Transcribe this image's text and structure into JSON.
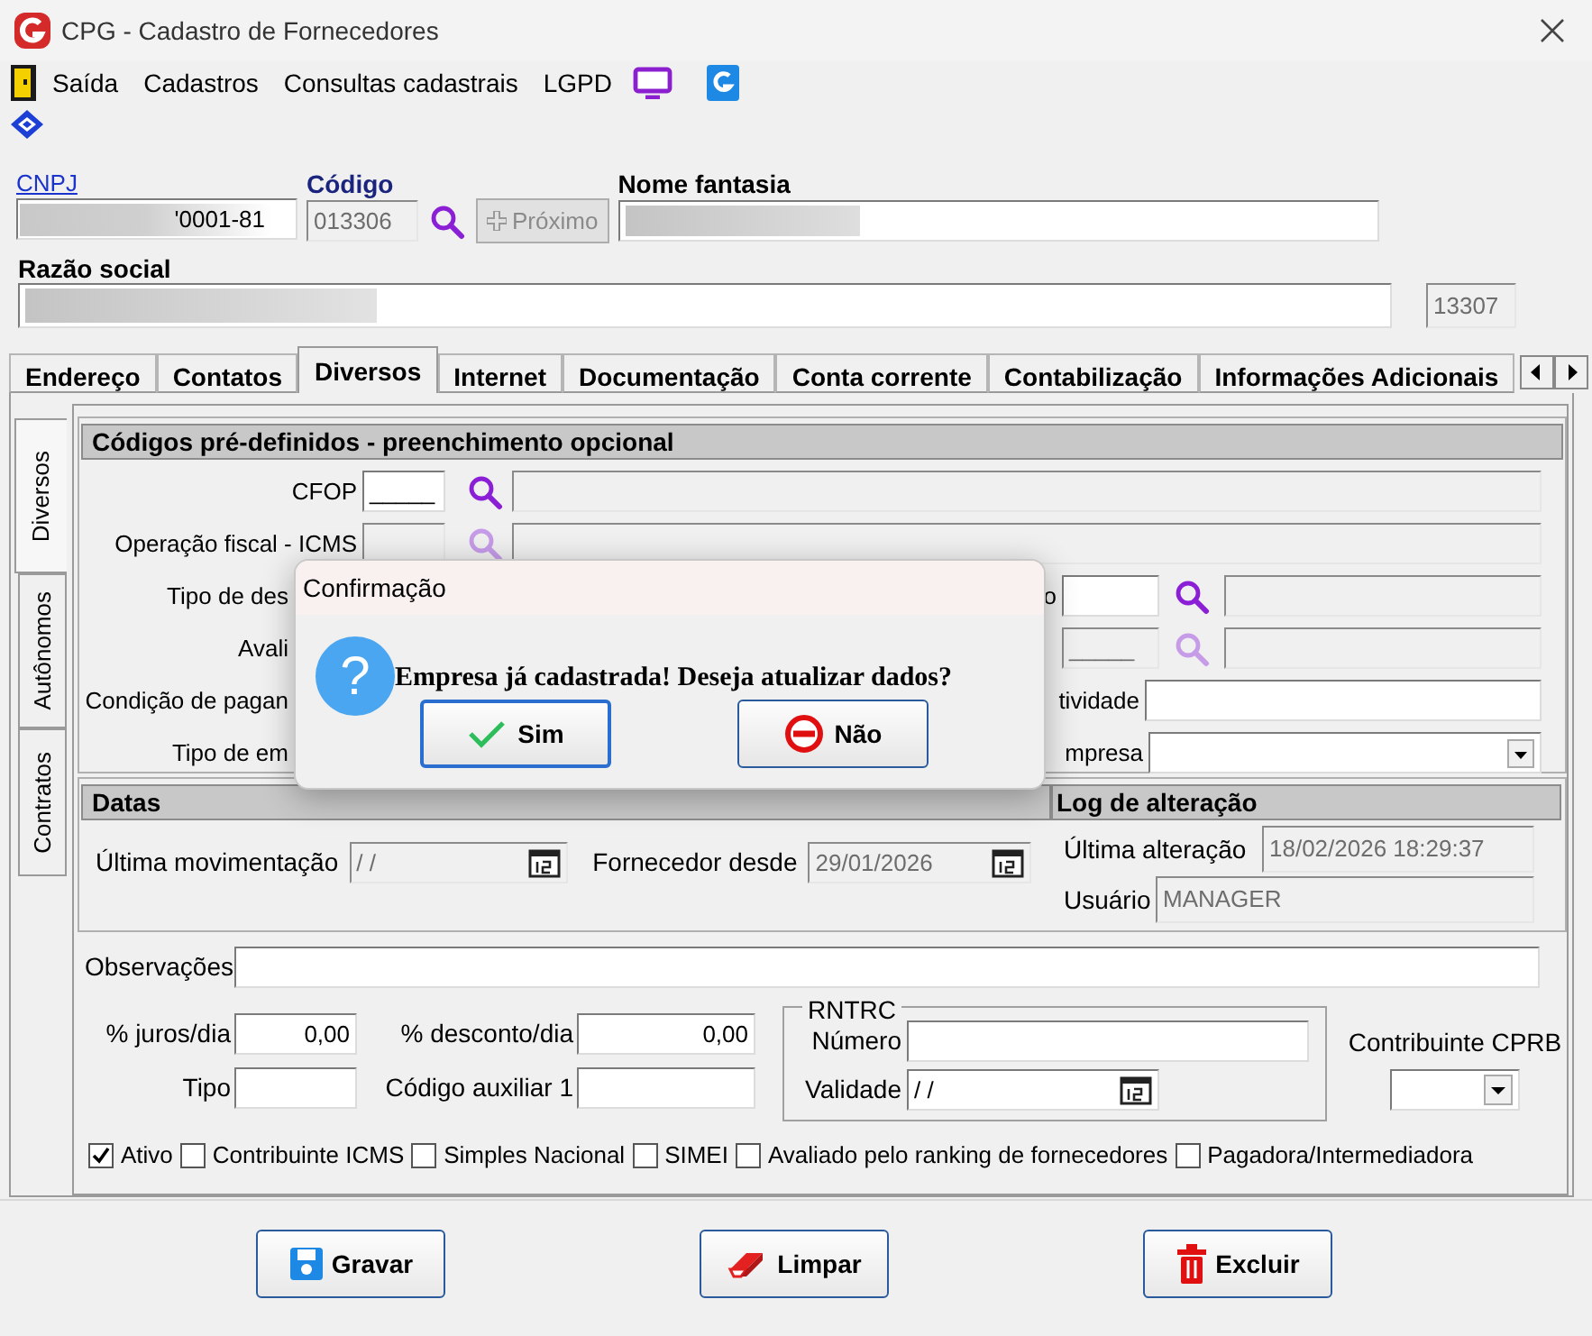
{
  "window": {
    "title": "CPG - Cadastro de Fornecedores"
  },
  "menu": [
    {
      "label": "Saída"
    },
    {
      "label": "Cadastros"
    },
    {
      "label": "Consultas cadastrais"
    },
    {
      "label": "LGPD"
    }
  ],
  "header": {
    "cnpj": {
      "label": "CNPJ",
      "value": "'0001-81"
    },
    "codigo": {
      "label": "Código",
      "value": "013306"
    },
    "proximo": {
      "label": "Próximo",
      "disabled": true
    },
    "nome_fantasia": {
      "label": "Nome fantasia"
    },
    "razao_social": {
      "label": "Razão social"
    },
    "numero": "13307"
  },
  "tabs": [
    {
      "label": "Endereço",
      "selected": false
    },
    {
      "label": "Contatos",
      "selected": false
    },
    {
      "label": "Diversos",
      "selected": true
    },
    {
      "label": "Internet",
      "selected": false
    },
    {
      "label": "Documentação",
      "selected": false
    },
    {
      "label": "Conta corrente",
      "selected": false
    },
    {
      "label": "Contabilização",
      "selected": false
    },
    {
      "label": "Informações Adicionais",
      "selected": false
    }
  ],
  "side_tabs": [
    {
      "label": "Diversos",
      "selected": true
    },
    {
      "label": "Autônomos",
      "selected": false
    },
    {
      "label": "Contratos",
      "selected": false
    }
  ],
  "codigos": {
    "title": "Códigos pré-definidos - preenchimento opcional",
    "rows": [
      {
        "kind": "lookup",
        "label": "CFOP",
        "value": "_____",
        "lookup_enabled": true
      },
      {
        "kind": "lookup",
        "label": "Operação fiscal - ICMS",
        "lookup_enabled": false
      },
      {
        "kind": "split",
        "label": "Tipo de des",
        "right_label": "o",
        "lookup_enabled": true
      },
      {
        "kind": "split",
        "label": "Avali",
        "right_value": "_____",
        "lookup_enabled": false
      },
      {
        "kind": "text",
        "label": "Condição de pagan",
        "right_label": "tividade"
      },
      {
        "kind": "select",
        "label": "Tipo de em",
        "right_label": "mpresa"
      }
    ]
  },
  "datas": {
    "title": "Datas",
    "ultima_movimentacao": {
      "label": "Última movimentação",
      "value": " / /"
    },
    "fornecedor_desde": {
      "label": "Fornecedor desde",
      "value": "29/01/2026"
    }
  },
  "log": {
    "title": "Log de alteração",
    "ultima_alteracao": {
      "label": "Última alteração",
      "value": "18/02/2026 18:29:37"
    },
    "usuario": {
      "label": "Usuário",
      "value": "MANAGER"
    }
  },
  "observacoes": {
    "label": "Observações"
  },
  "juros": {
    "label": "% juros/dia",
    "value": "0,00"
  },
  "desconto": {
    "label": "% desconto/dia",
    "value": "0,00"
  },
  "tipo": {
    "label": "Tipo"
  },
  "codigo_auxiliar": {
    "label": "Código auxiliar 1"
  },
  "rntrc": {
    "title": "RNTRC",
    "numero": {
      "label": "Número"
    },
    "validade": {
      "label": "Validade",
      "value": " / /"
    }
  },
  "cprb": {
    "label": "Contribuinte CPRB"
  },
  "checkboxes": [
    {
      "label": "Ativo",
      "checked": true
    },
    {
      "label": "Contribuinte ICMS",
      "checked": false
    },
    {
      "label": "Simples Nacional",
      "checked": false
    },
    {
      "label": "SIMEI",
      "checked": false
    },
    {
      "label": "Avaliado pelo ranking de fornecedores",
      "checked": false
    },
    {
      "label": "Pagadora/Intermediadora",
      "checked": false
    }
  ],
  "buttons": [
    {
      "kind": "save",
      "label": "Gravar"
    },
    {
      "kind": "clear",
      "label": "Limpar"
    },
    {
      "kind": "delete",
      "label": "Excluir"
    }
  ],
  "dialog": {
    "title": "Confirmação",
    "icon": "?",
    "message": "Empresa já cadastrada! Deseja atualizar dados?",
    "buttons": [
      {
        "kind": "yes",
        "label": "Sim",
        "selected": true
      },
      {
        "kind": "no",
        "label": "Não",
        "selected": false
      }
    ]
  }
}
